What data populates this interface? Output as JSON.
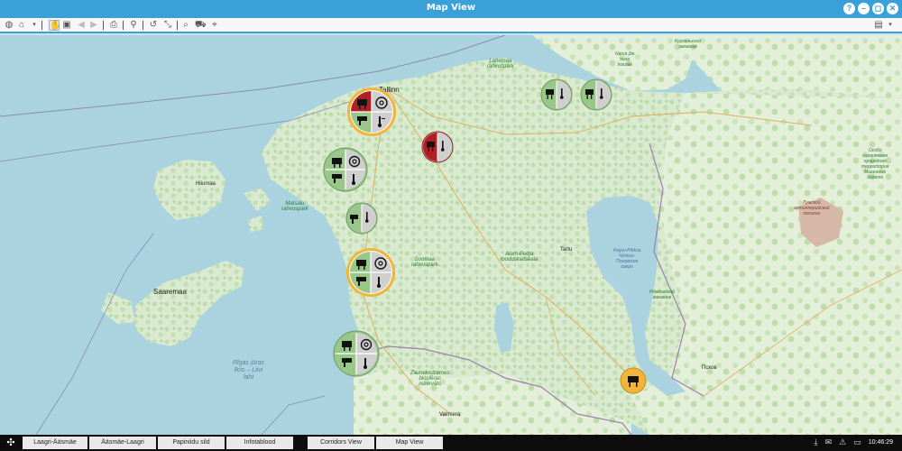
{
  "window": {
    "title": "Map View"
  },
  "window_buttons": [
    {
      "name": "help-button",
      "glyph": "?"
    },
    {
      "name": "minimize-button",
      "glyph": "–"
    },
    {
      "name": "restore-button",
      "glyph": "◻"
    },
    {
      "name": "close-button",
      "glyph": "✕"
    }
  ],
  "toolbar": {
    "icons": [
      "globe-icon",
      "home-icon",
      "hand-pan-icon",
      "zoom-box-icon",
      "back-icon",
      "forward-icon",
      "print-icon",
      "pin-icon",
      "history-icon",
      "measure-icon",
      "zoom-in-icon",
      "vehicle-icon",
      "crosshair-icon",
      "layers-icon"
    ]
  },
  "map": {
    "labels": {
      "tallinn": "Tallinn",
      "tartu": "Tartu",
      "valmiera": "Valmiera",
      "pskov": "Псков",
      "saaremaa": "Saaremaa",
      "hiiumaa": "Hiiumaa",
      "riga_gulf": "Rīgas jūras\nlīcis – Liivi\nlaht",
      "lahemaa": "Lahemaa\nrahvuspark",
      "soomaa": "Soomaa\nrahvuspark",
      "matsalu": "Matsalu\nrahvuspark",
      "alam_pedja": "Alam-Pedja\nlooduskaitseala",
      "ziemelvidzeme": "Ziemeļvidzemes\nbiosfēras\nrezervāts",
      "kurgalsky": "Кургальский\nзаказник",
      "narva": "Narva jõe\nsuue\nhoiuala",
      "remdovsky": "Ремдовский\nзаказник",
      "pyhajarve": "Peipsi-Pihkva\nЧудско-\nПсковское\nозеро",
      "luzhsky": "Лужский\nартиллерийский\nполигон",
      "ru_reserve": "Особо\nохраняемая\nприродная\nтерритория\nМшинское\nболото"
    },
    "markers": [
      {
        "id": "tallinn-group",
        "status": "alert"
      },
      {
        "id": "kohtla-group-1",
        "status": "ok"
      },
      {
        "id": "kohtla-group-2",
        "status": "ok"
      },
      {
        "id": "central-north",
        "status": "critical"
      },
      {
        "id": "haapsalu-group",
        "status": "ok"
      },
      {
        "id": "lihula-group",
        "status": "ok"
      },
      {
        "id": "parnu-group",
        "status": "alert"
      },
      {
        "id": "ainazi-group",
        "status": "ok"
      },
      {
        "id": "southeast-single",
        "status": "warning"
      }
    ]
  },
  "taskbar": {
    "tabs": [
      "Laagri-Ääsmäe",
      "Ääsmäe-Laagri",
      "Papiniidu sild",
      "Infotablood",
      "",
      "Corridors View",
      "Map View"
    ],
    "clock": "10:46:29",
    "tray_icons": [
      "download-icon",
      "mail-icon",
      "warning-icon",
      "battery-icon"
    ]
  },
  "colors": {
    "accent": "#3aa0d8",
    "ok": "#98c789",
    "critical": "#b01f24",
    "warning": "#f2b53a",
    "neutral": "#cfcfcf"
  }
}
